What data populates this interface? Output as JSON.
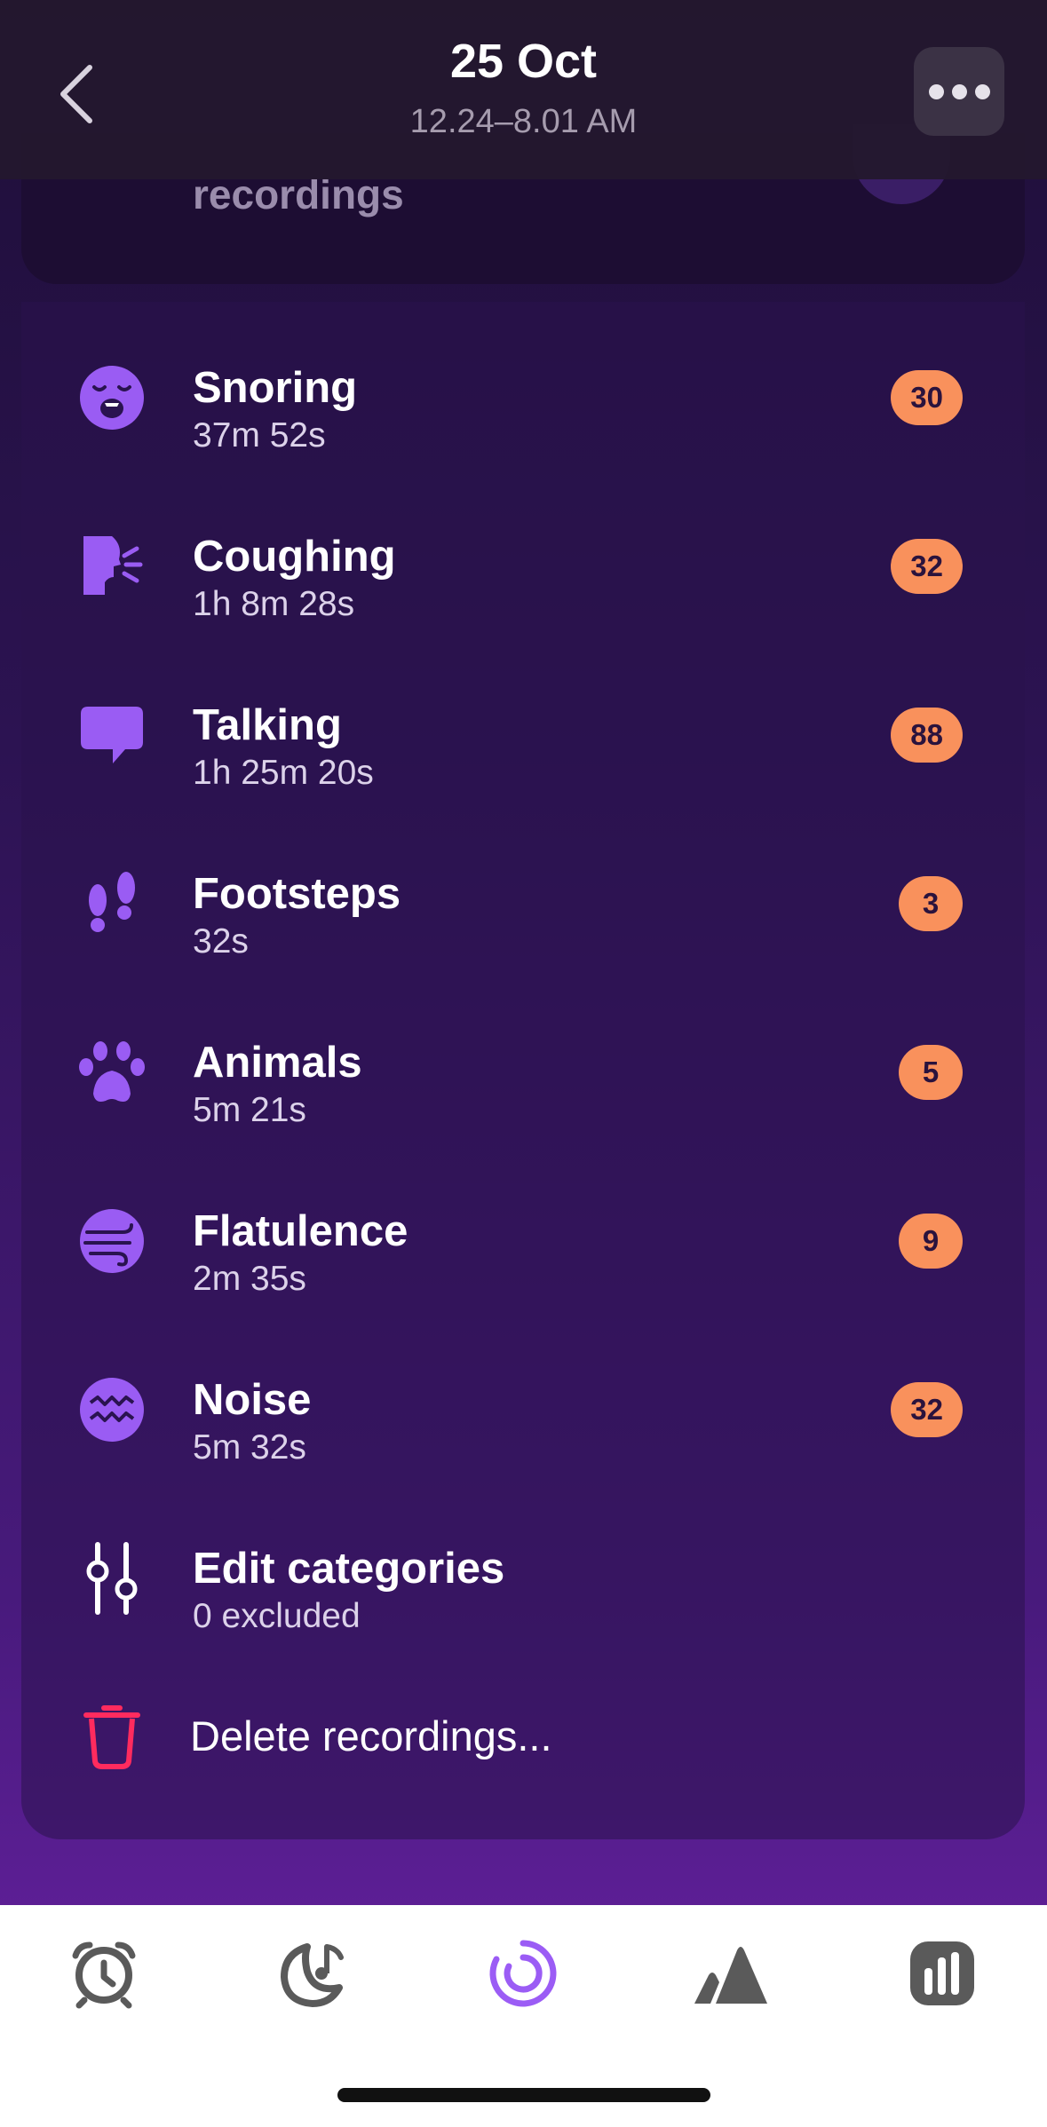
{
  "header": {
    "title": "25 Oct",
    "subtitle": "12.24–8.01 AM"
  },
  "previous_card": {
    "label": "recordings"
  },
  "categories": [
    {
      "icon": "snoring-face-icon",
      "name": "Snoring",
      "duration": "37m 52s",
      "count": "30"
    },
    {
      "icon": "coughing-icon",
      "name": "Coughing",
      "duration": "1h 8m 28s",
      "count": "32"
    },
    {
      "icon": "speech-bubble-icon",
      "name": "Talking",
      "duration": "1h 25m 20s",
      "count": "88"
    },
    {
      "icon": "footsteps-icon",
      "name": "Footsteps",
      "duration": "32s",
      "count": "3"
    },
    {
      "icon": "paw-icon",
      "name": "Animals",
      "duration": "5m 21s",
      "count": "5"
    },
    {
      "icon": "wind-icon",
      "name": "Flatulence",
      "duration": "2m 35s",
      "count": "9"
    },
    {
      "icon": "noise-wave-icon",
      "name": "Noise",
      "duration": "5m 32s",
      "count": "32"
    }
  ],
  "edit_categories": {
    "icon": "sliders-icon",
    "label": "Edit categories",
    "sublabel": "0 excluded"
  },
  "delete": {
    "icon": "trash-icon",
    "label": "Delete recordings..."
  },
  "tabbar": {
    "items": [
      {
        "name": "alarm",
        "icon": "alarm-clock-icon",
        "active": false
      },
      {
        "name": "sleep-sounds",
        "icon": "moon-music-icon",
        "active": false
      },
      {
        "name": "tracking",
        "icon": "progress-ring-icon",
        "active": true
      },
      {
        "name": "dreams",
        "icon": "mountain-icon",
        "active": false
      },
      {
        "name": "statistics",
        "icon": "bar-chart-icon",
        "active": false
      }
    ]
  },
  "colors": {
    "accent": "#9b5cf5",
    "badge": "#f9915c",
    "delete": "#ff2b5e",
    "icon_purple": "#9a5cf3",
    "tab_inactive": "#5a5a5a"
  }
}
